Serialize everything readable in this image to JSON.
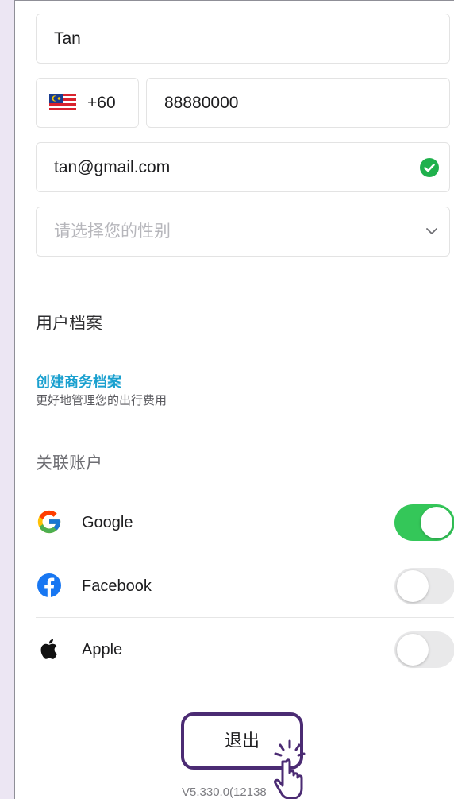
{
  "form": {
    "name_value": "Tan",
    "country_flag": "malaysia-flag-icon",
    "dial_code": "+60",
    "phone_value": "88880000",
    "email_value": "tan@gmail.com",
    "email_status_icon": "check-circle-icon",
    "gender_placeholder": "请选择您的性别"
  },
  "profile": {
    "section_title": "用户档案",
    "create_business_link": "创建商务档案",
    "create_business_subtitle": "更好地管理您的出行费用"
  },
  "linked_accounts": {
    "section_title": "关联账户",
    "items": [
      {
        "label": "Google",
        "icon": "google-icon",
        "enabled": true
      },
      {
        "label": "Facebook",
        "icon": "facebook-icon",
        "enabled": false
      },
      {
        "label": "Apple",
        "icon": "apple-icon",
        "enabled": false
      }
    ]
  },
  "footer": {
    "logout_label": "退出",
    "version": "V5.330.0(12138"
  },
  "colors": {
    "accent_link": "#1aa0cf",
    "toggle_on": "#34c759",
    "highlight_border": "#4b2b73",
    "background": "#ece6f3"
  }
}
